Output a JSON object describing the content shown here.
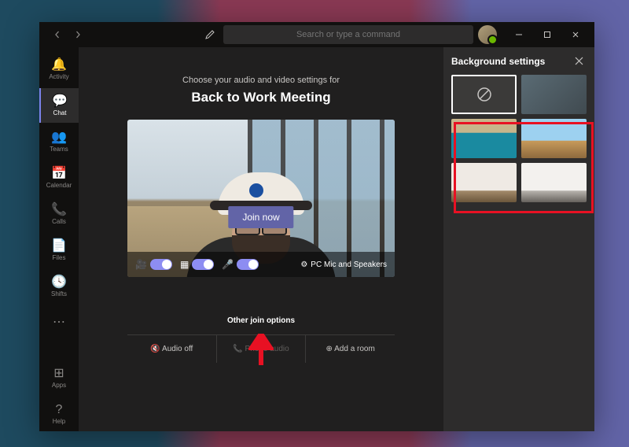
{
  "titlebar": {
    "search_placeholder": "Search or type a command"
  },
  "rail": {
    "items": [
      {
        "label": "Activity"
      },
      {
        "label": "Chat"
      },
      {
        "label": "Teams"
      },
      {
        "label": "Calendar"
      },
      {
        "label": "Calls"
      },
      {
        "label": "Files"
      },
      {
        "label": "Shifts"
      }
    ],
    "apps_label": "Apps",
    "help_label": "Help"
  },
  "prejoin": {
    "subtitle": "Choose your audio and video settings for",
    "meeting_title": "Back to Work Meeting",
    "join_label": "Join now",
    "device_label": "PC Mic and Speakers",
    "other_options_label": "Other join options",
    "options": {
      "audio_off": "Audio off",
      "phone_audio": "Phone audio",
      "add_room": "Add a room"
    }
  },
  "panel": {
    "title": "Background settings"
  }
}
